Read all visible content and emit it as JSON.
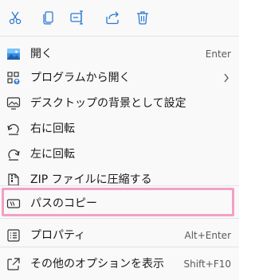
{
  "toolbar": {
    "buttons": [
      {
        "icon": "cut-icon"
      },
      {
        "icon": "copy-icon"
      },
      {
        "icon": "rename-icon"
      },
      {
        "icon": "share-icon"
      },
      {
        "icon": "delete-icon"
      }
    ]
  },
  "menu": {
    "items": [
      {
        "label": "開く",
        "shortcut": "Enter",
        "icon": "image-icon"
      },
      {
        "label": "プログラムから開く",
        "shortcut": "",
        "icon": "open-with-icon",
        "has_submenu": true
      },
      {
        "label": "デスクトップの背景として設定",
        "shortcut": "",
        "icon": "desktop-background-icon"
      },
      {
        "label": "右に回転",
        "shortcut": "",
        "icon": "rotate-right-icon"
      },
      {
        "label": "左に回転",
        "shortcut": "",
        "icon": "rotate-left-icon"
      },
      {
        "label": "ZIP ファイルに圧縮する",
        "shortcut": "",
        "icon": "zip-icon"
      },
      {
        "label": "パスのコピー",
        "shortcut": "",
        "icon": "copy-path-icon",
        "highlighted": true
      },
      {
        "label": "プロパティ",
        "shortcut": "Alt+Enter",
        "icon": "properties-icon"
      },
      {
        "label": "その他のオプションを表示",
        "shortcut": "Shift+F10",
        "icon": "more-options-icon"
      }
    ]
  },
  "colors": {
    "accent": "#2b79d4",
    "highlight_border": "#f2a0c4",
    "background": "#f9f9f9"
  }
}
